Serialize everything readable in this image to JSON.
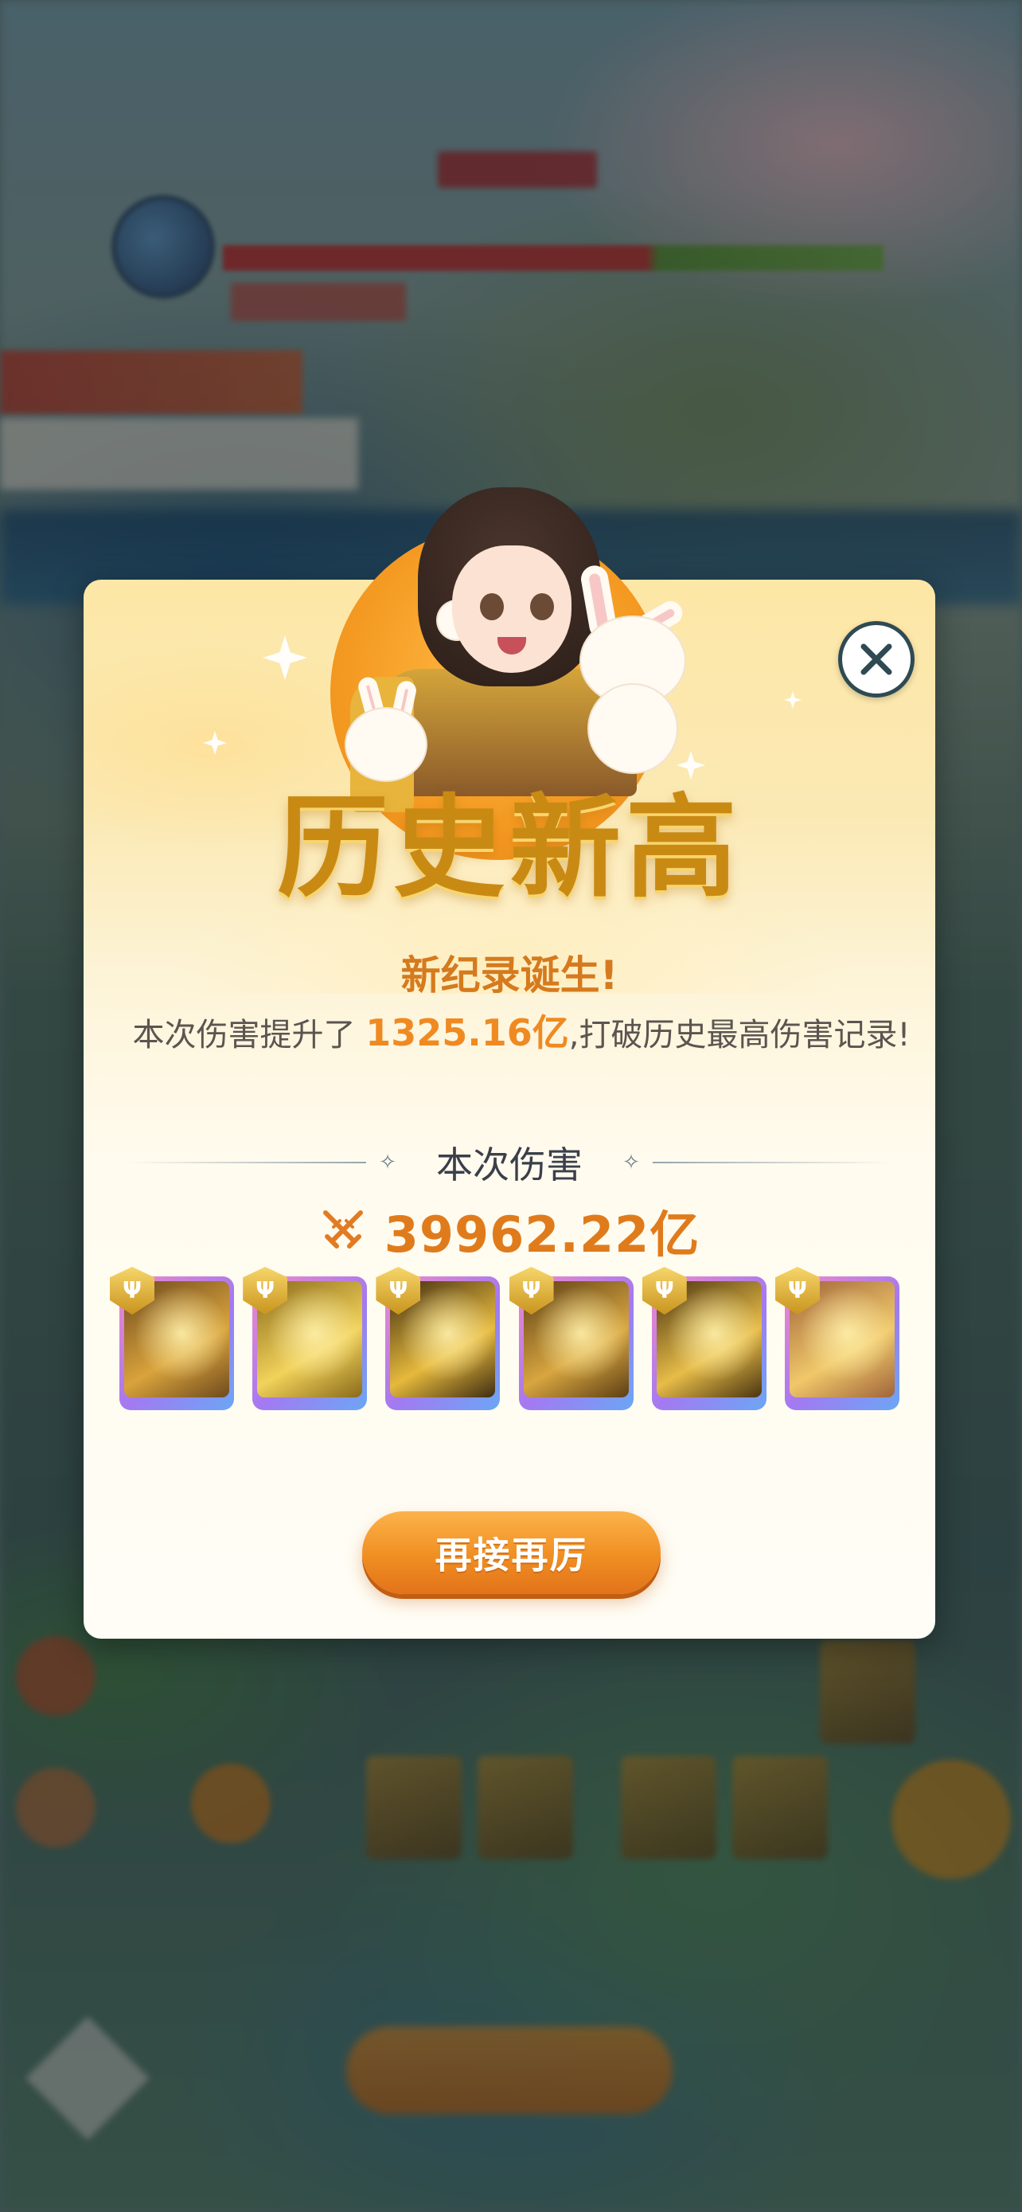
{
  "modal": {
    "title": "历史新高",
    "subtitle": "新纪录诞生!",
    "desc_prefix": "本次伤害提升了 ",
    "desc_highlight": "1325.16亿",
    "desc_suffix": ",打破历史最高伤害记录!",
    "section_label": "本次伤害",
    "damage_value": "39962.22亿",
    "cta_label": "再接再厉",
    "close_icon": "close-icon",
    "damage_icon": "crossed-swords-icon"
  },
  "skills": [
    {
      "name": "skill-golden-daggers",
      "tone": [
        "#6e4a1e",
        "#d9a33c"
      ]
    },
    {
      "name": "skill-golden-burst",
      "tone": [
        "#8a6a1a",
        "#f1d25a"
      ]
    },
    {
      "name": "skill-golden-beam",
      "tone": [
        "#3e2c12",
        "#e6b93c"
      ]
    },
    {
      "name": "skill-golden-dragon",
      "tone": [
        "#5c3e14",
        "#d8a640"
      ]
    },
    {
      "name": "skill-golden-phoenix",
      "tone": [
        "#4a3410",
        "#e7bc48"
      ]
    },
    {
      "name": "skill-golden-goddess",
      "tone": [
        "#a0643a",
        "#f0c86a"
      ]
    }
  ],
  "colors": {
    "accent_orange": "#e07b1c",
    "title_gold": "#c98a14",
    "skill_frame_pink": "#f489c8",
    "skill_frame_blue": "#6aa7f5"
  }
}
